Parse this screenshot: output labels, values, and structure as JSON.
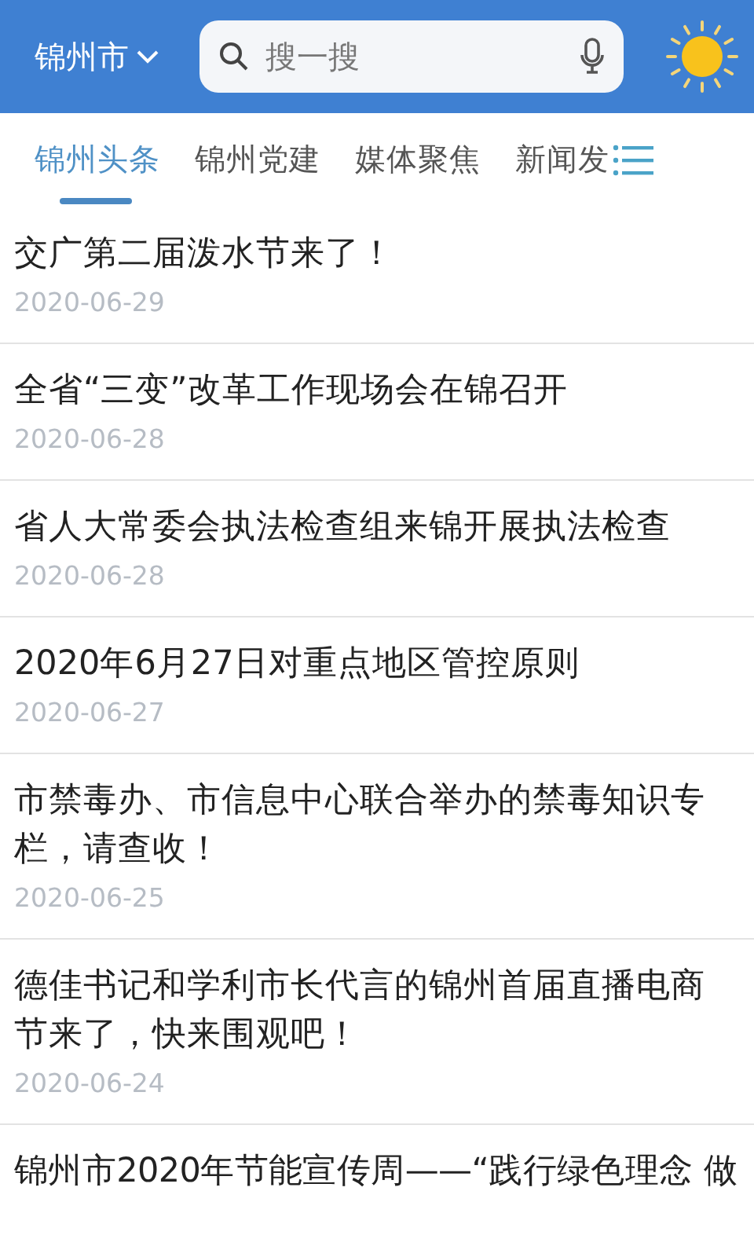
{
  "header": {
    "city": "锦州市",
    "search": {
      "placeholder": "搜一搜"
    }
  },
  "tabs": [
    {
      "label": "锦州头条",
      "selected": true
    },
    {
      "label": "锦州党建",
      "selected": false
    },
    {
      "label": "媒体聚焦",
      "selected": false
    },
    {
      "label": "新闻发",
      "selected": false
    }
  ],
  "news": [
    {
      "title": "交广第二届泼水节来了！",
      "date": "2020-06-29"
    },
    {
      "title": "全省“三变”改革工作现场会在锦召开",
      "date": "2020-06-28"
    },
    {
      "title": "省人大常委会执法检查组来锦开展执法检查",
      "date": "2020-06-28"
    },
    {
      "title": "2020年6月27日对重点地区管控原则",
      "date": "2020-06-27"
    },
    {
      "title": "市禁毒办、市信息中心联合举办的禁毒知识专栏，请查收！",
      "date": "2020-06-25"
    },
    {
      "title": "德佳书记和学利市长代言的锦州首届直播电商节来了，快来围观吧！",
      "date": "2020-06-24"
    },
    {
      "title": "锦州市2020年节能宣传周——“践行绿色理念 做"
    }
  ]
}
